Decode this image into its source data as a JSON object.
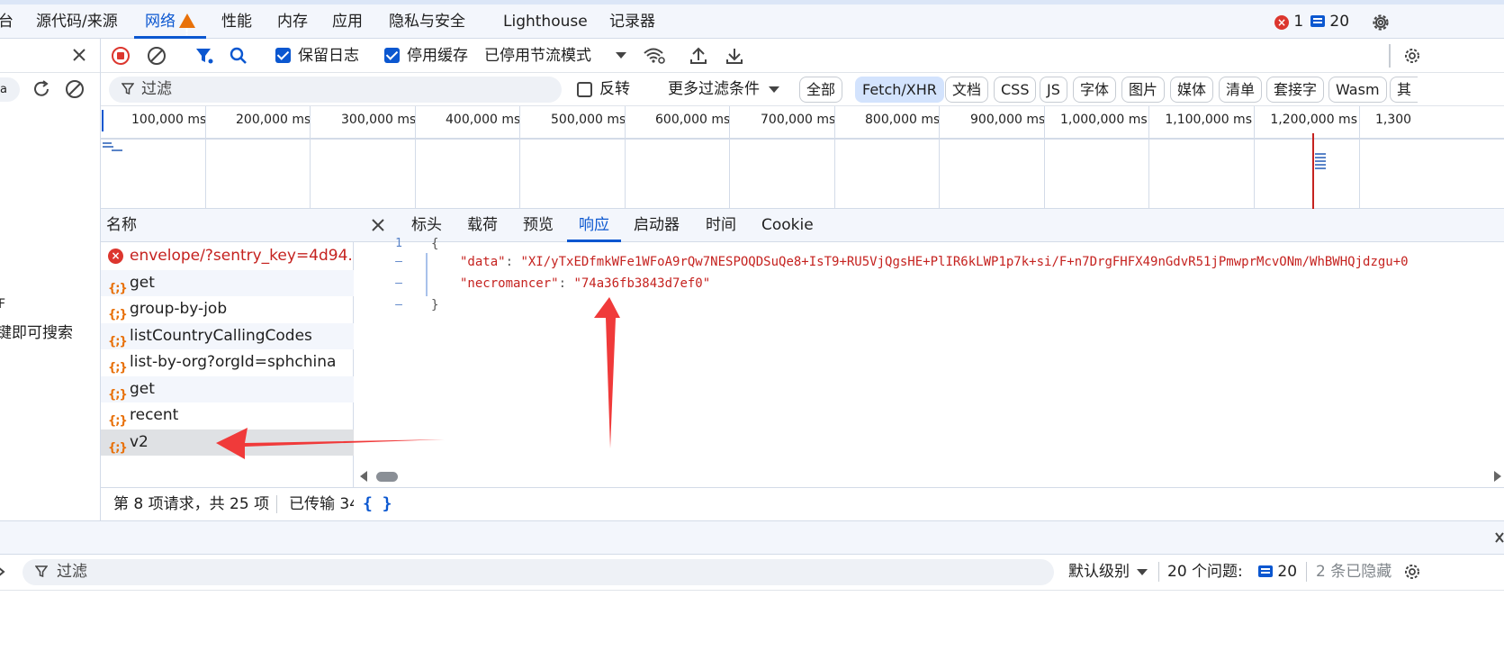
{
  "main_tabs": [
    {
      "label": "台"
    },
    {
      "label": "源代码/来源"
    },
    {
      "label": "网络"
    },
    {
      "label": "性能"
    },
    {
      "label": "内存"
    },
    {
      "label": "应用"
    },
    {
      "label": "隐私与安全"
    },
    {
      "label": "Lighthouse"
    },
    {
      "label": "记录器"
    }
  ],
  "issues": {
    "errors": "1",
    "messages": "20"
  },
  "toolbar": {
    "preserve_log": "保留日志",
    "disable_cache": "停用缓存",
    "throttle": "已停用节流模式"
  },
  "left_panel": {
    "search_value": "a",
    "hint_line1": "F",
    "hint_line2": "键即可搜索"
  },
  "filter": {
    "placeholder": "过滤",
    "invert": "反转",
    "more_filters": "更多过滤条件",
    "types": [
      "全部",
      "Fetch/XHR",
      "文档",
      "CSS",
      "JS",
      "字体",
      "图片",
      "媒体",
      "清单",
      "套接字",
      "Wasm",
      "其"
    ]
  },
  "timeline": {
    "ticks": [
      "100,000 ms",
      "200,000 ms",
      "300,000 ms",
      "400,000 ms",
      "500,000 ms",
      "600,000 ms",
      "700,000 ms",
      "800,000 ms",
      "900,000 ms",
      "1,000,000 ms",
      "1,100,000 ms",
      "1,200,000 ms",
      "1,300"
    ]
  },
  "request_list": {
    "header": "名称",
    "rows": [
      {
        "name": "envelope/?sentry_key=4d94...",
        "type": "error"
      },
      {
        "name": "get",
        "type": "xhr"
      },
      {
        "name": "group-by-job",
        "type": "xhr"
      },
      {
        "name": "listCountryCallingCodes",
        "type": "xhr"
      },
      {
        "name": "list-by-org?orgId=sphchina",
        "type": "xhr"
      },
      {
        "name": "get",
        "type": "xhr"
      },
      {
        "name": "recent",
        "type": "xhr"
      },
      {
        "name": "v2",
        "type": "xhr"
      }
    ]
  },
  "detail_tabs": [
    {
      "label": "标头"
    },
    {
      "label": "载荷"
    },
    {
      "label": "预览"
    },
    {
      "label": "响应"
    },
    {
      "label": "启动器"
    },
    {
      "label": "时间"
    },
    {
      "label": "Cookie"
    }
  ],
  "response": {
    "line_no": "1",
    "open_brace": "{",
    "close_brace": "}",
    "gutter_mark": "–",
    "data_key": "\"data\"",
    "data_value": "\"XI/yTxEDfmkWFe1WFoA9rQw7NESPOQDSuQe8+IsT9+RU5VjQgsHE+PlIR6kLWP1p7k+si/F+n7DrgFHFX49nGdvR51jPmwprMcvONm/WhBWHQjdzgu+0",
    "necro_key": "\"necromancer\"",
    "necro_value": "\"74a36fb3843d7ef0\"",
    "colon": ": ",
    "comma": ","
  },
  "status": {
    "requests": "第 8 项请求，共 25 项",
    "transferred": "已传输 34",
    "format_icon": "{ }"
  },
  "console": {
    "filter_placeholder": "过滤",
    "level": "默认级别",
    "issues_label": "20 个问题:",
    "issues_count": "20",
    "hidden": "2 条已隐藏"
  },
  "colors": {
    "accent": "#0b57d0",
    "error": "#c5221f",
    "arrow": "#f03a3a",
    "xhr_icon": "#e8710a"
  }
}
